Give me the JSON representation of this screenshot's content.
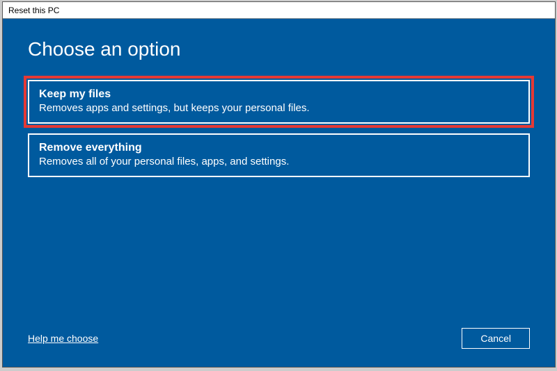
{
  "window": {
    "title": "Reset this PC"
  },
  "heading": "Choose an option",
  "options": [
    {
      "title": "Keep my files",
      "description": "Removes apps and settings, but keeps your personal files.",
      "highlighted": true
    },
    {
      "title": "Remove everything",
      "description": "Removes all of your personal files, apps, and settings.",
      "highlighted": false
    }
  ],
  "footer": {
    "help_link": "Help me choose",
    "cancel_label": "Cancel"
  }
}
